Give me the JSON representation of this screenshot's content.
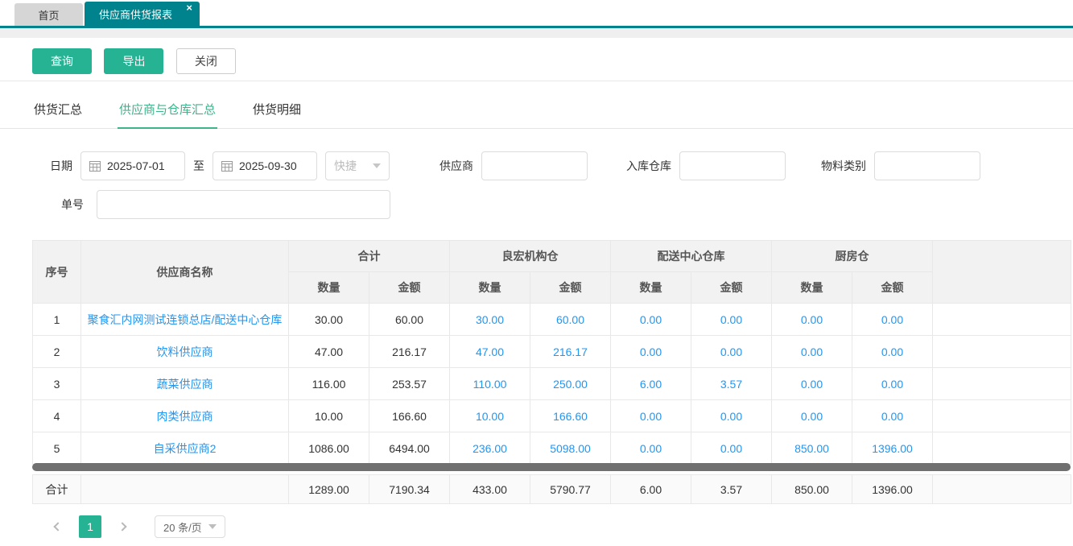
{
  "window": {
    "tabs": [
      {
        "label": "首页",
        "active": false
      },
      {
        "label": "供应商供货报表",
        "active": true
      }
    ],
    "close_icon": "×"
  },
  "toolbar": {
    "query": "查询",
    "export": "导出",
    "close": "关闭"
  },
  "view_tabs": [
    {
      "label": "供货汇总",
      "active": false
    },
    {
      "label": "供应商与仓库汇总",
      "active": true
    },
    {
      "label": "供货明细",
      "active": false
    }
  ],
  "filters": {
    "date_label": "日期",
    "date_from": "2025-07-01",
    "to_label": "至",
    "date_to": "2025-09-30",
    "quick_label": "快捷",
    "supplier_label": "供应商",
    "supplier_value": "",
    "warehouse_label": "入库仓库",
    "warehouse_value": "",
    "material_label": "物料类别",
    "material_value": "",
    "order_label": "单号",
    "order_value": ""
  },
  "table": {
    "index_header": "序号",
    "name_header": "供应商名称",
    "col_groups": [
      "合计",
      "良宏机构仓",
      "配送中心仓库",
      "厨房仓"
    ],
    "sub_headers": [
      "数量",
      "金额"
    ],
    "rows": [
      {
        "index": "1",
        "name": "聚食汇内网测试连锁总店/配送中心仓库",
        "values": [
          "30.00",
          "60.00",
          "30.00",
          "60.00",
          "0.00",
          "0.00",
          "0.00",
          "0.00"
        ]
      },
      {
        "index": "2",
        "name": "饮料供应商",
        "values": [
          "47.00",
          "216.17",
          "47.00",
          "216.17",
          "0.00",
          "0.00",
          "0.00",
          "0.00"
        ]
      },
      {
        "index": "3",
        "name": "蔬菜供应商",
        "values": [
          "116.00",
          "253.57",
          "110.00",
          "250.00",
          "6.00",
          "3.57",
          "0.00",
          "0.00"
        ]
      },
      {
        "index": "4",
        "name": "肉类供应商",
        "values": [
          "10.00",
          "166.60",
          "10.00",
          "166.60",
          "0.00",
          "0.00",
          "0.00",
          "0.00"
        ]
      },
      {
        "index": "5",
        "name": "自采供应商2",
        "values": [
          "1086.00",
          "6494.00",
          "236.00",
          "5098.00",
          "0.00",
          "0.00",
          "850.00",
          "1396.00"
        ]
      }
    ],
    "total_label": "合计",
    "totals": [
      "1289.00",
      "7190.34",
      "433.00",
      "5790.77",
      "6.00",
      "3.57",
      "850.00",
      "1396.00"
    ]
  },
  "pagination": {
    "page": "1",
    "page_size": "20 条/页"
  },
  "colors": {
    "accent_teal": "#00838c",
    "button_teal": "#26b394",
    "active_tab_green": "#3eb48b",
    "link_blue": "#2196f3",
    "scrollbar_gray": "#707070"
  }
}
